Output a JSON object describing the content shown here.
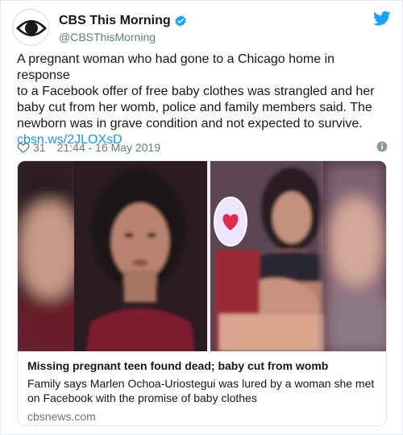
{
  "account": {
    "display_name": "CBS This Morning",
    "handle": "@CBSThisMorning"
  },
  "tweet": {
    "text_lines": [
      "A pregnant woman who had gone to a Chicago home in response",
      "to a Facebook offer of free baby clothes was strangled and her",
      "baby cut from her womb, police and family members said. The",
      "newborn was in grave condition and not expected to survive."
    ],
    "link": "cbsn.ws/2JLOXsD",
    "likes": "31",
    "timestamp": "21:44 - 16 May 2019"
  },
  "card": {
    "title": "Missing pregnant teen found dead; baby cut from womb",
    "description_lines": [
      "Family says Marlen Ochoa-Uriostegui was lured by a woman she met",
      "on Facebook with the promise of baby clothes"
    ],
    "domain": "cbsnews.com"
  },
  "icons": {
    "avatar": "cbs-eye-logo",
    "verified": "verified-badge-icon",
    "brand": "twitter-bird-icon",
    "like": "heart-icon",
    "info": "info-icon"
  },
  "colors": {
    "link": "#1b95e0",
    "verified": "#1da1f2",
    "muted": "#657786",
    "text": "#14171a"
  }
}
